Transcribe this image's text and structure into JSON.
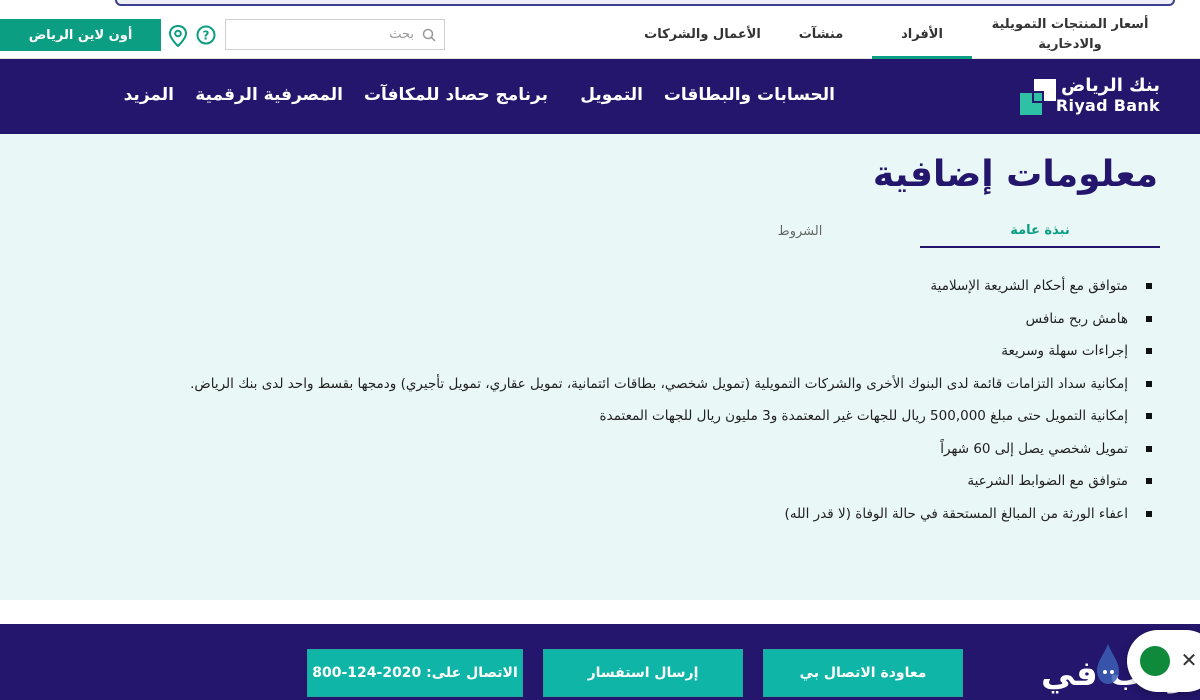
{
  "header": {
    "online_button": "أون لاين الرياض",
    "search": {
      "placeholder": "بحث"
    },
    "segments": [
      {
        "label": "أسعار المنتجات التمويلية والادخارية"
      },
      {
        "label": "الأفراد",
        "active": true
      },
      {
        "label": "منشآت"
      },
      {
        "label": "الأعمال والشركات"
      }
    ]
  },
  "nav": {
    "logo": {
      "ar": "بنك الرياض",
      "en": "Riyad Bank"
    },
    "items": [
      {
        "label": "الحسابات والبطاقات"
      },
      {
        "label": "التمويل"
      },
      {
        "label": "برنامج حصاد للمكافآت"
      },
      {
        "label": "المصرفية الرقمية"
      },
      {
        "label": "المزيد"
      }
    ]
  },
  "main": {
    "title": "معلومات إضافية",
    "tabs": [
      {
        "label": "نبذة عامة",
        "active": true
      },
      {
        "label": "الشروط"
      }
    ],
    "features": [
      "متوافق مع أحكام الشريعة الإسلامية",
      "هامش ربح منافس",
      "إجراءات سهلة وسريعة",
      "إمكانية سداد التزامات قائمة لدى البنوك الأخرى والشركات التمويلية (تمويل شخصي، بطاقات ائتمانية، تمويل عقاري، تمويل تأجيري) ودمجها بقسط واحد لدى بنك الرياض.",
      "إمكانية التمويل حتى مبلغ 500,000 ريال للجهات غير المعتمدة و3 مليون ريال للجهات المعتمدة",
      "تمويل شخصي يصل إلى 60 شهراً",
      "متوافق مع الضوابط الشرعية",
      "اعفاء الورثة من المبالغ المستحقة في حالة الوفاة (لا قدر الله)"
    ]
  },
  "footer": {
    "label": "أرغب في :",
    "buttons": [
      {
        "label": "معاودة الاتصال بي"
      },
      {
        "label": "إرسال استفسار"
      },
      {
        "label": "الاتصال على: 2020-124-800"
      }
    ]
  },
  "colors": {
    "brand_navy": "#23166c",
    "brand_green": "#0b9e82",
    "teal_button": "#0fb5a7",
    "content_bg": "#eaf7f7"
  },
  "icons": [
    "search-icon",
    "location-pin-icon",
    "help-circle-icon",
    "riyad-bank-logo-mark",
    "close-icon",
    "chat-avatar-icon",
    "drop-icon"
  ]
}
